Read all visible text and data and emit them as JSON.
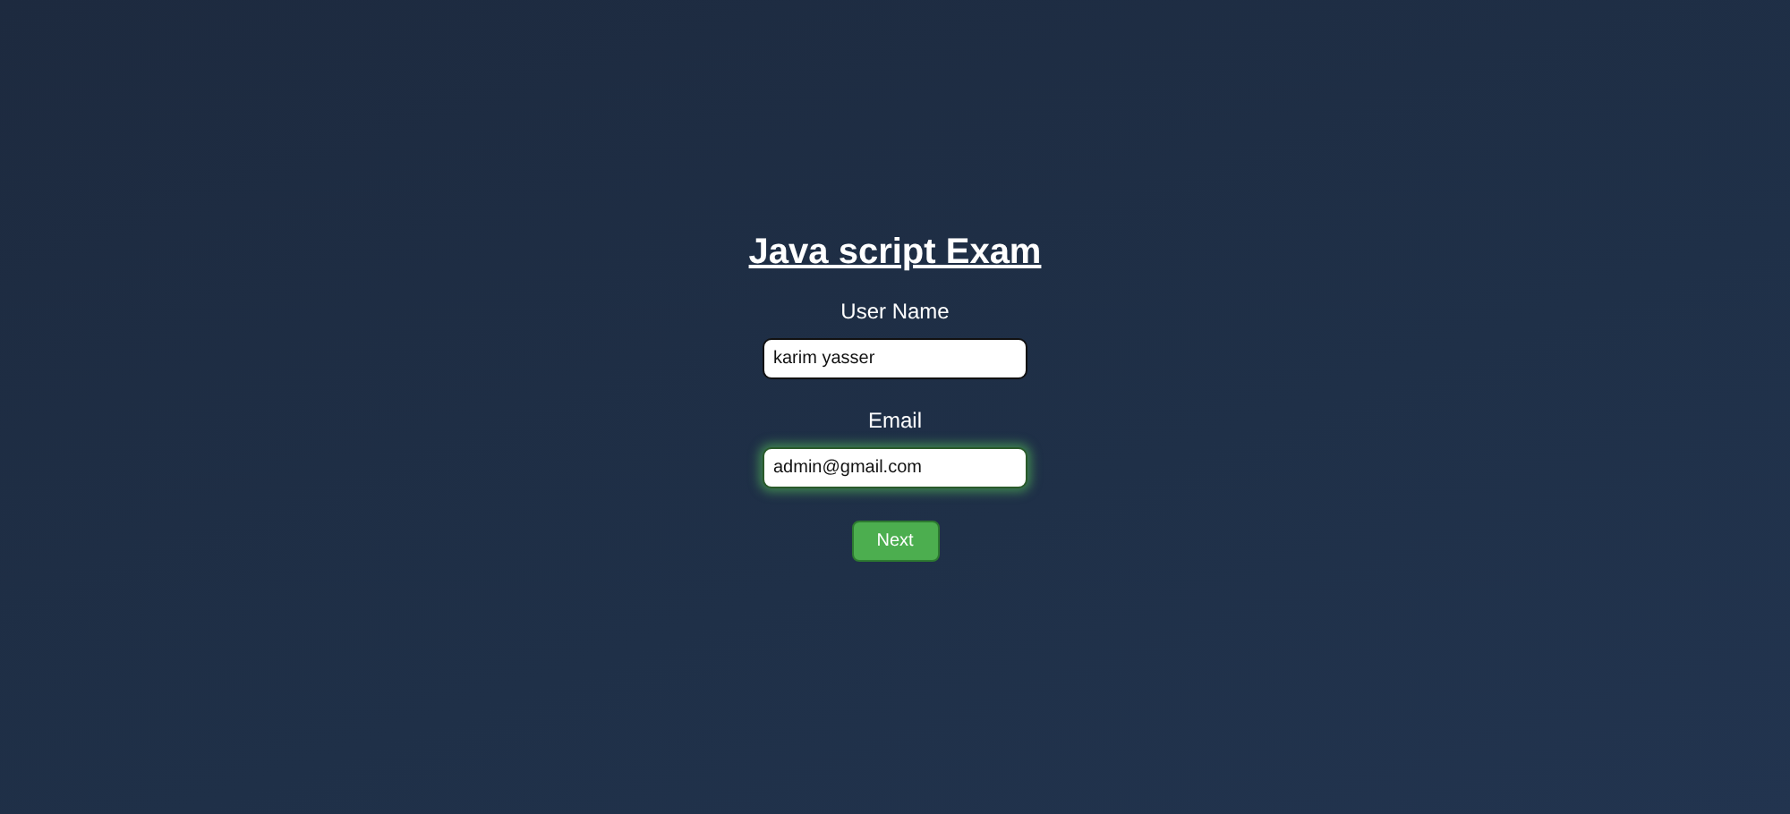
{
  "title": "Java script Exam",
  "fields": [
    {
      "label": "User Name",
      "value": "karim yasser",
      "focused": false
    },
    {
      "label": "Email",
      "value": "admin@gmail.com",
      "focused": true
    }
  ],
  "button": {
    "label": "Next"
  }
}
